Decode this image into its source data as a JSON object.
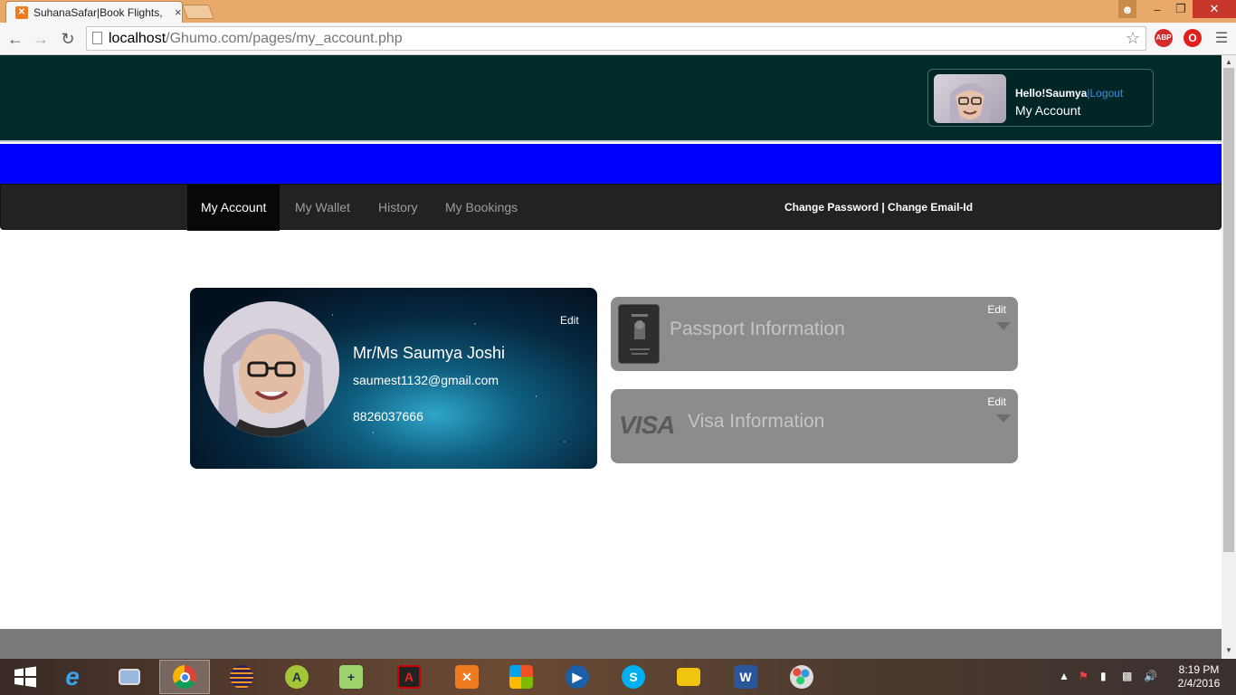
{
  "browser": {
    "tab_title": "SuhanaSafar|Book Flights,",
    "tab_close": "×",
    "url_host": "localhost",
    "url_path": "/Ghumo.com/pages/my_account.php",
    "ext_abp": "ABP"
  },
  "header": {
    "greeting": "Hello!Saumya",
    "logout": "|Logout",
    "my_account": "My Account"
  },
  "navbar": {
    "items": [
      "My Account",
      "My Wallet",
      "History",
      "My Bookings"
    ],
    "active": "My Account",
    "links": "Change Password | Change Email-Id"
  },
  "profile": {
    "name": "Mr/Ms Saumya Joshi",
    "email": "saumest1132@gmail.com",
    "phone": "8826037666",
    "edit": "Edit"
  },
  "passport": {
    "title": "Passport Information",
    "edit": "Edit"
  },
  "visa": {
    "title": "Visa Information",
    "edit": "Edit",
    "logo": "VISA"
  },
  "taskbar": {
    "time": "8:19 PM",
    "date": "2/4/2016",
    "apps": [
      "start",
      "internet-explorer",
      "this-pc",
      "chrome",
      "eclipse",
      "android-studio",
      "notepad-plus",
      "acrobat",
      "xampp",
      "windows-store",
      "media-player",
      "skype",
      "file-explorer",
      "word",
      "paint"
    ]
  },
  "colors": {
    "header_bg": "#002b2b",
    "blue_bar": "#0000ff",
    "navbar_bg": "#222222",
    "panel_bg": "#8c8c8c"
  }
}
